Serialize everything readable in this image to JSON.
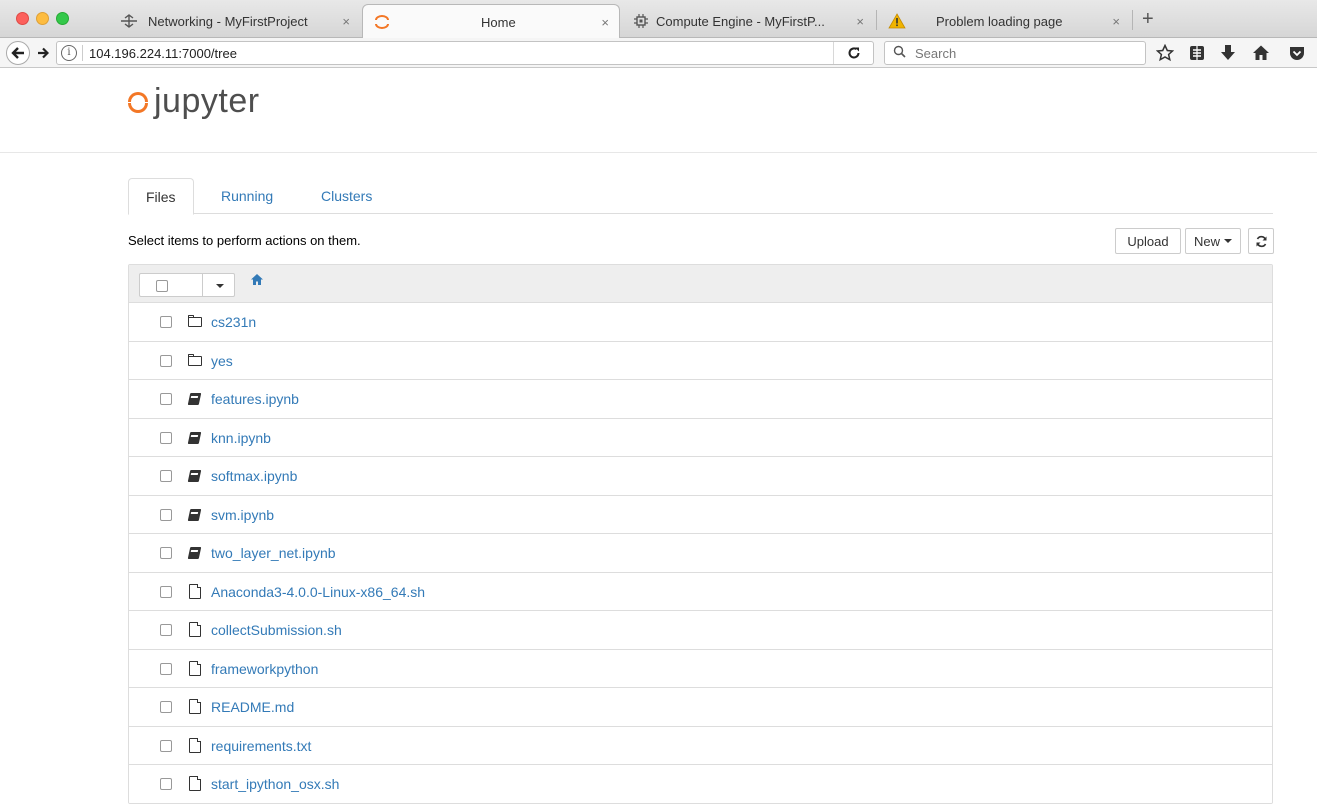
{
  "browser": {
    "tabs": [
      {
        "title": "Networking - MyFirstProject",
        "icon": "network-icon",
        "active": false
      },
      {
        "title": "Home",
        "icon": "jupyter-icon",
        "active": true
      },
      {
        "title": "Compute Engine - MyFirstP...",
        "icon": "chip-icon",
        "active": false
      },
      {
        "title": "Problem loading page",
        "icon": "warning-icon",
        "active": false
      }
    ],
    "tab_close": "×",
    "new_tab": "+",
    "url": "104.196.224.11:7000/tree",
    "search_placeholder": "Search",
    "glyphs": {
      "back": "🡐",
      "forward": "➔",
      "info": "i",
      "reload": "C",
      "search": "🔍",
      "bookmark": "☆",
      "reader": "▤",
      "download": "⬇",
      "home": "⌂",
      "pocket": "⛉"
    }
  },
  "jupyter": {
    "logo_text": "jupyter",
    "tabs": [
      "Files",
      "Running",
      "Clusters"
    ],
    "instructions": "Select items to perform actions on them.",
    "buttons": {
      "upload": "Upload",
      "new": "New",
      "refresh": "↻"
    },
    "home_glyph": "⌂",
    "files": [
      {
        "name": "cs231n",
        "type": "folder"
      },
      {
        "name": "yes",
        "type": "folder"
      },
      {
        "name": "features.ipynb",
        "type": "notebook"
      },
      {
        "name": "knn.ipynb",
        "type": "notebook"
      },
      {
        "name": "softmax.ipynb",
        "type": "notebook"
      },
      {
        "name": "svm.ipynb",
        "type": "notebook"
      },
      {
        "name": "two_layer_net.ipynb",
        "type": "notebook"
      },
      {
        "name": "Anaconda3-4.0.0-Linux-x86_64.sh",
        "type": "file"
      },
      {
        "name": "collectSubmission.sh",
        "type": "file"
      },
      {
        "name": "frameworkpython",
        "type": "file"
      },
      {
        "name": "README.md",
        "type": "file"
      },
      {
        "name": "requirements.txt",
        "type": "file"
      },
      {
        "name": "start_ipython_osx.sh",
        "type": "file"
      }
    ]
  },
  "colors": {
    "link": "#337ab7",
    "jupyter_orange": "#f37726",
    "warning": "#f0b400"
  }
}
